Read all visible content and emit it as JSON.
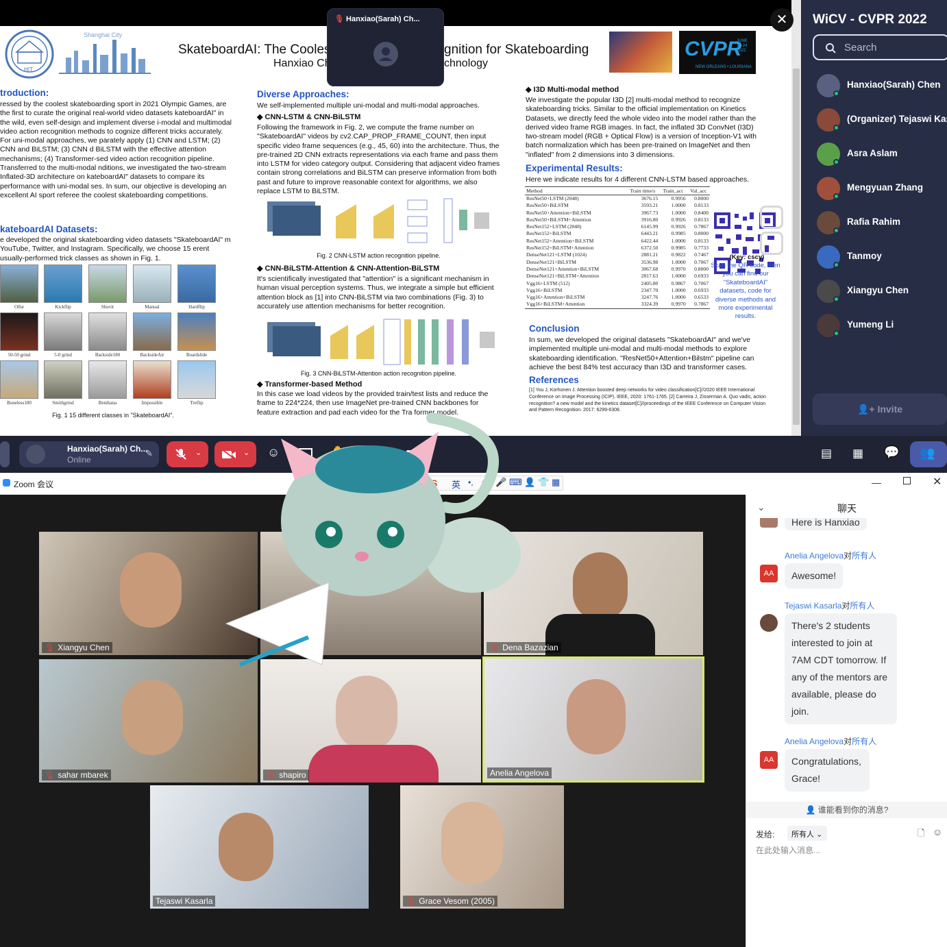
{
  "gather": {
    "video_pip": {
      "name": "Hanxiao(Sarah) Ch..."
    },
    "poster": {
      "title": "SkateboardAI: The Coolest Video Action Recognition for Skateboarding",
      "title_left": "SkateboardAI: The Cooles",
      "title_right": "gnition for Skateboarding",
      "subtitle_left": "Hanxiao Ch",
      "subtitle_right": "chnology",
      "cvpr_logo": "CVPR",
      "cvpr_date": "JUNE 19-24 2022",
      "cvpr_loc": "NEW ORLEANS • LOUISIANA",
      "intro_heading": "troduction:",
      "intro_text": "ressed by the coolest skateboarding sport in 2021 Olympic Games, are the first to curate the original real-world video datasets kateboardAI\" in the wild, even self-design and implement diverse i-modal and multimodal video action recognition methods to cognize different tricks accurately. For uni-modal approaches, we parately apply (1) CNN and LSTM; (2) CNN and BiLSTM; (3) CNN d BiLSTM with the effective attention mechanisms; (4) Transformer-sed video action recognition pipeline. Transferred to the multi-modal nditions, we investigated the two-stream Inflated-3D architecture on kateboardAI\" datasets to compare its performance with uni-modal ses. In sum, our objective is developing an excellent AI sport referee the coolest skateboarding competitions.",
      "datasets_heading": "kateboardAI Datasets:",
      "datasets_text": "e developed the original skateboarding video datasets \"SkateboardAI\" m YouTube, Twitter, and Instagram. Specifically, we choose 15 erent usually-performed trick classes as shown in Fig. 1.",
      "classes": [
        "Ollie",
        "Kickflip",
        "Shuvit",
        "Manual",
        "Hardflip",
        "50-50 grind",
        "5-0 grind",
        "Backside180",
        "BacksideAir",
        "Boardslide",
        "Boneless180",
        "Smithgrind",
        "Benihana",
        "Impossible",
        "Treflip"
      ],
      "fig1_caption": "Fig. 1 15 different classes in \"SkateboardAI\".",
      "diverse_heading": "Diverse Approaches:",
      "diverse_text": "We self-implemented multiple uni-modal and multi-modal approaches.",
      "cnn_lstm_heading": "◆ CNN-LSTM & CNN-BiLSTM",
      "cnn_lstm_text": "Following the framework in Fig. 2, we compute the frame number on \"SkateboardAI\" videos by cv2.CAP_PROP_FRAME_COUNT, then input specific video frame sequences (e.g., 45, 60) into the architecture. Thus, the pre-trained 2D CNN extracts representations via each frame and pass them into LSTM for video category output. Considering that adjacent video frames contain strong correlations and BiLSTM can preserve information from both past and future to improve reasonable context for algorithms, we also replace LSTM to BiLSTM.",
      "fig2_caption": "Fig. 2 CNN-LSTM action recognition pipeline.",
      "attn_heading": "◆ CNN-BiLSTM-Attention & CNN-Attention-BiLSTM",
      "attn_text": "It's scientifically investigated that \"attention\" is a significant mechanism in human visual perception systems. Thus, we integrate a simple but efficient attention block as [1] into CNN-BiLSTM via two combinations (Fig. 3) to accurately use attention mechanisms for better recognition.",
      "fig3_caption": "Fig. 3 CNN-BiLSTM-Attention action recognition pipeline.",
      "transformer_heading": "◆ Transformer-based Method",
      "transformer_text": "In this case we load videos by the provided train/test lists and reduce the frame to 224*224, then use ImageNet pre-trained CNN backbones for feature extraction and pad each video for the Tra     former model.",
      "i3d_heading": "◆ I3D Multi-modal method",
      "i3d_text": "We investigate the popular I3D [2] multi-modal method to recognize skateboarding tricks. Similar to the official implementation on Kinetics Datasets, we directly feed the whole video into the model rather than the derived video frame RGB images. In fact, the inflated 3D ConvNet (I3D) two-stream model (RGB + Optical Flow) is a version of Inception-V1 with batch normalization which has been pre-trained on ImageNet and then \"inflated\" from 2 dimensions into 3 dimensions.",
      "results_heading": "Experimental Results:",
      "results_text": "Here we indicate results for 4 different CNN-LSTM based approaches.",
      "table_headers": [
        "Method",
        "Train time/s",
        "Train_acc",
        "Val_acc"
      ],
      "table_rows": [
        [
          "ResNet50+LSTM (2048)",
          "3676.15",
          "0.9956",
          "0.8000"
        ],
        [
          "ResNet50+BiLSTM",
          "3593.21",
          "1.0000",
          "0.8133"
        ],
        [
          "ResNet50+Attention+BiLSTM",
          "3967.73",
          "1.0000",
          "0.8400"
        ],
        [
          "ResNet50+BiLSTM+Attention",
          "3916.80",
          "0.9926",
          "0.8133"
        ],
        [
          "ResNet152+LSTM (2048)",
          "6145.99",
          "0.9926",
          "0.7867"
        ],
        [
          "ResNet152+BiLSTM",
          "6443.21",
          "0.9985",
          "0.8000"
        ],
        [
          "ResNet152+Attention+BiLSTM",
          "6422.44",
          "1.0000",
          "0.8133"
        ],
        [
          "ResNet152+BiLSTM+Attention",
          "6372.50",
          "0.9985",
          "0.7733"
        ],
        [
          "DenseNet121+LSTM (1024)",
          "2881.21",
          "0.9822",
          "0.7467"
        ],
        [
          "DenseNet121+BiLSTM",
          "3536.98",
          "1.0000",
          "0.7067"
        ],
        [
          "DenseNet121+Attention+BiLSTM",
          "3067.68",
          "0.9970",
          "0.8000"
        ],
        [
          "DenseNet121+BiLSTM+Attention",
          "2817.63",
          "1.0000",
          "0.6933"
        ],
        [
          "Vgg16+LSTM (512)",
          "2405.80",
          "0.9867",
          "0.7067"
        ],
        [
          "Vgg16+BiLSTM",
          "2347.70",
          "1.0000",
          "0.6933"
        ],
        [
          "Vgg16+Attention+BiLSTM",
          "3247.76",
          "1.0000",
          "0.6533"
        ],
        [
          "Vgg16+BiLSTM+Attention",
          "3324.39",
          "0.9970",
          "0.7867"
        ]
      ],
      "qr_key": "(Key: cscy)",
      "qr_text": "Scan the QR code, then you can find our \"SkateboardAI\" datasets, code for diverse methods and more experimental results.",
      "conclusion_heading": "Conclusion",
      "conclusion_text": "In sum, we developed the original datasets \"SkateboardAI\" and we've implemented multiple uni-modal and multi-modal methods to explore skateboarding identification. \"ResNet50+Attention+Bilstm\" pipeline can achieve the best 84% test accuracy than I3D and transformer cases.",
      "references_heading": "References",
      "references_text": "[1] You J, Korhonen J. Attention boosted deep networks for video classification[C]//2020 IEEE International Conference on Image Processing (ICIP). IEEE, 2020: 1761-1765. [2] Carreira J, Zisserman A. Quo vadis, action recognition? a new model and the kinetics dataset[C]//proceedings of the IEEE Conference on Computer Vision and Pattern Recognition. 2017: 6299-6308."
    },
    "sidebar": {
      "title": "WiCV - CVPR 2022",
      "search_placeholder": "Search",
      "members": [
        {
          "name": "Hanxiao(Sarah) Chen",
          "color": "#5a6180"
        },
        {
          "name": "(Organizer) Tejaswi Kasarla",
          "color": "#8a4a3a"
        },
        {
          "name": "Asra Aslam",
          "color": "#5aa04a"
        },
        {
          "name": "Mengyuan Zhang",
          "color": "#a0503a"
        },
        {
          "name": "Rafia Rahim",
          "color": "#6a4a3a"
        },
        {
          "name": "Tanmoy",
          "color": "#3a6ac0"
        },
        {
          "name": "Xiangyu Chen",
          "color": "#4a4a4a"
        },
        {
          "name": "Yumeng Li",
          "color": "#4a3a3a"
        }
      ],
      "invite_label": "Invite"
    },
    "toolbar": {
      "user_name": "Hanxiao(Sarah) Ch...",
      "user_status": "Online"
    }
  },
  "zoom": {
    "window_title": "Zoom 会议",
    "ime_label": "英",
    "participants": [
      {
        "name": "Xiangyu Chen"
      },
      {
        "name": "Dena Bazazian"
      },
      {
        "name": "sahar mbarek"
      },
      {
        "name": "shapiro"
      },
      {
        "name": "Anelia Angelova"
      },
      {
        "name": "Tejaswi Kasarla"
      },
      {
        "name": "Grace Vesom (2005)"
      }
    ],
    "chat": {
      "title": "聊天",
      "partial_message": "Here is Hanxiao",
      "messages": [
        {
          "from": "Anelia Angelova",
          "to": "对",
          "target": "所有人",
          "avatar": "AA",
          "text": "Awesome!"
        },
        {
          "from": "Tejaswi Kasarla",
          "to": "对",
          "target": "所有人",
          "avatar": "",
          "text": "There's 2 students interested to join at 7AM CDT tomorrow. If any of the mentors are available, please do join."
        },
        {
          "from": "Anelia Angelova",
          "to": "对",
          "target": "所有人",
          "avatar": "AA",
          "text": "Congratulations, Grace!"
        }
      ],
      "who_can_see": "谁能看到你的消息?",
      "send_to_label": "发给:",
      "send_to_value": "所有人",
      "input_placeholder": "在此处输入消息..."
    }
  },
  "colors": {
    "accent_blue": "#2155c2",
    "gather_bg": "#1f2333",
    "zoom_active_border": "#d8e86a",
    "mute_red": "#e0443e"
  }
}
